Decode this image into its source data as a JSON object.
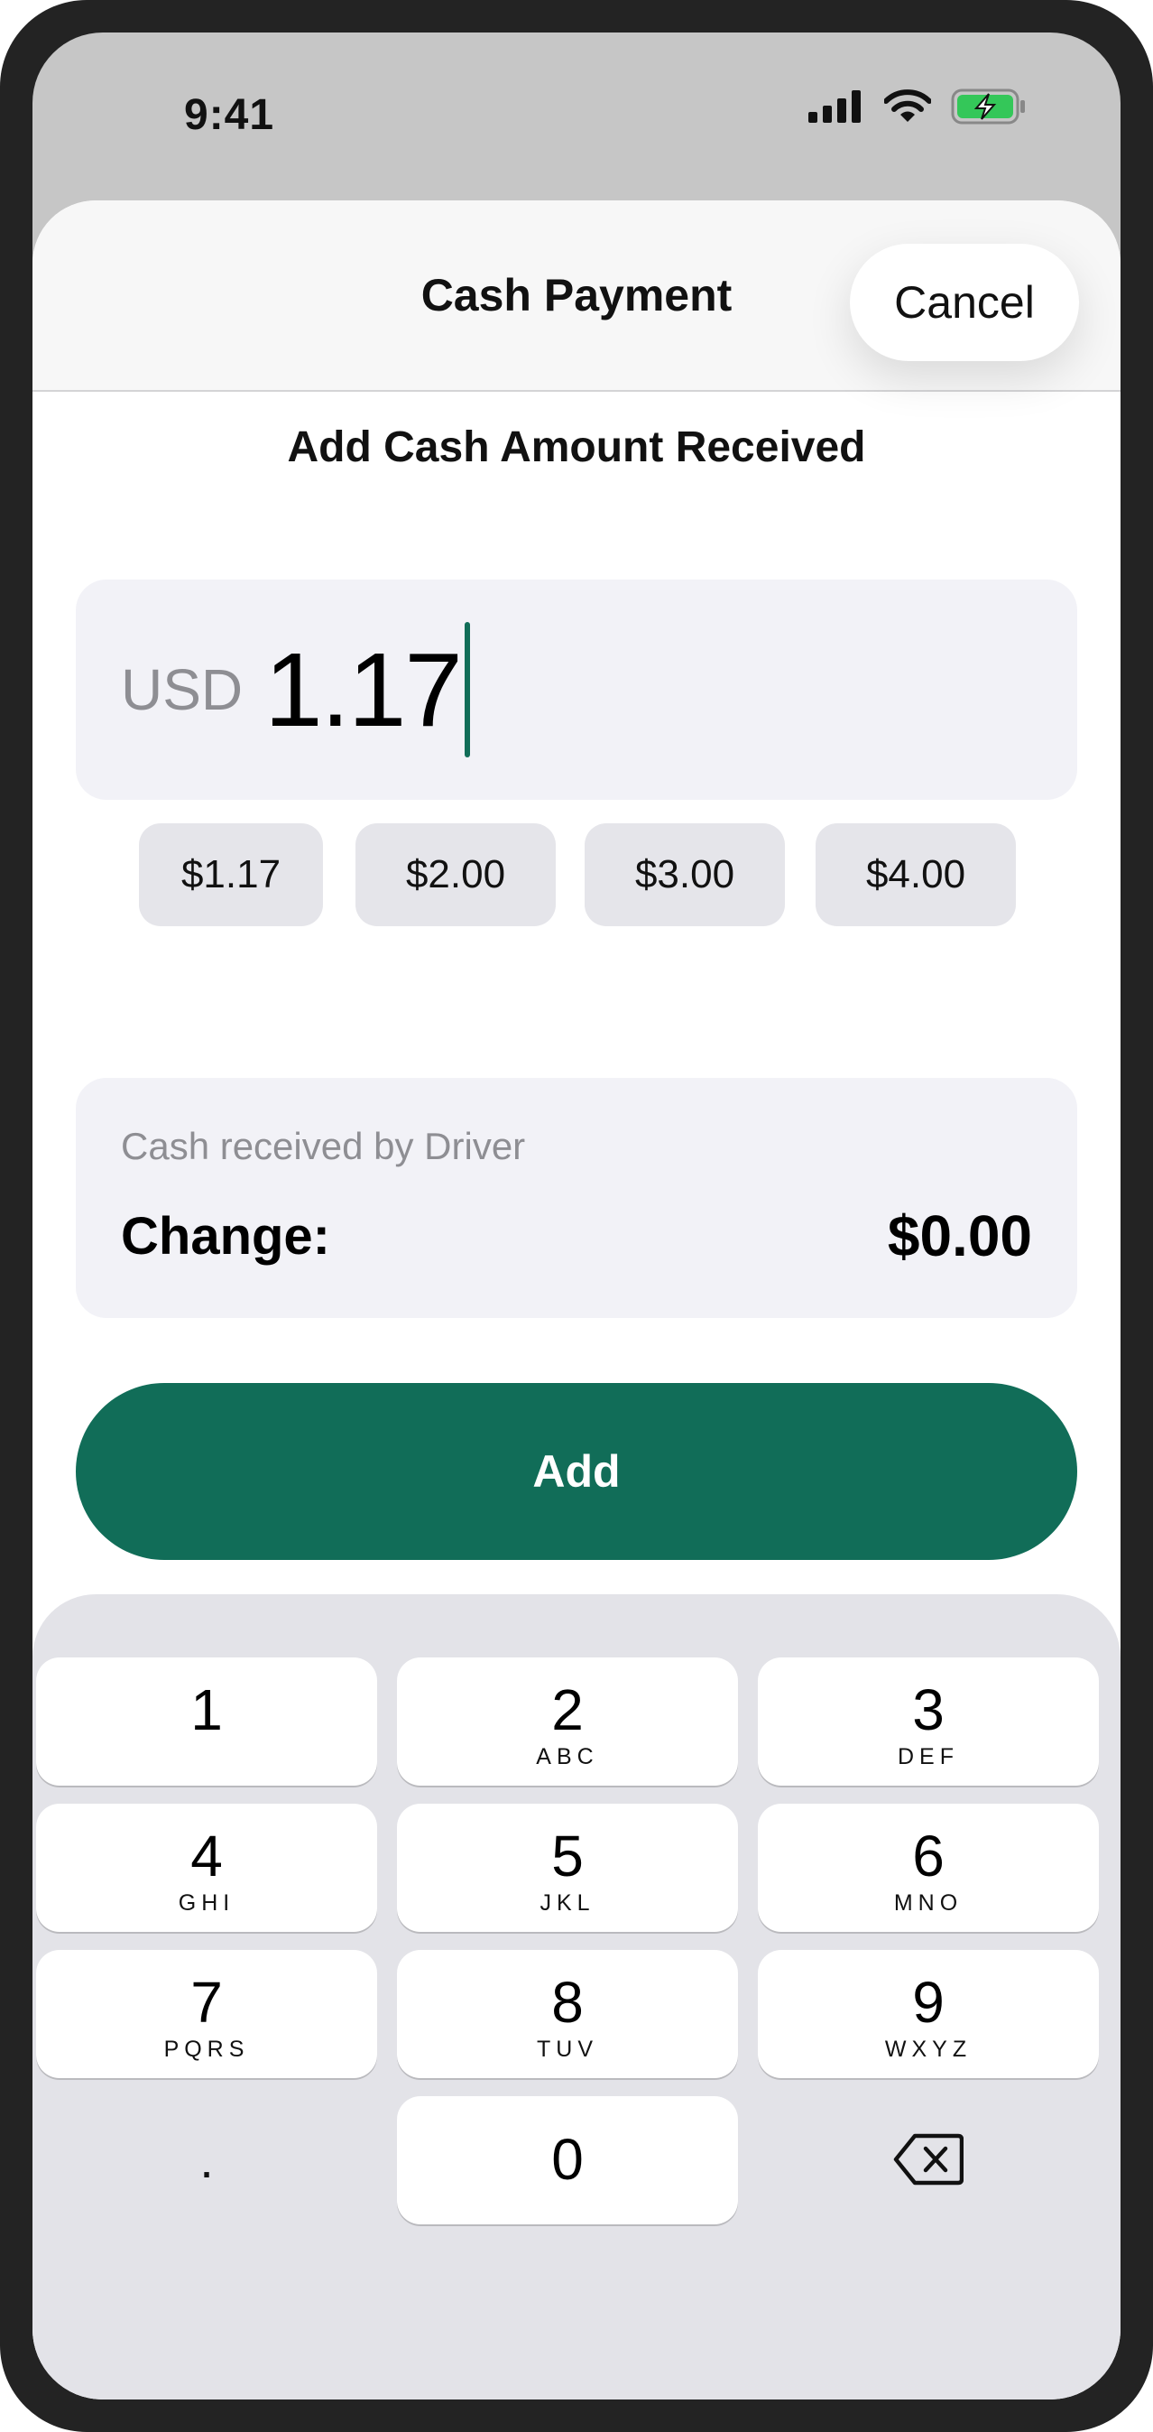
{
  "status_bar": {
    "time": "9:41"
  },
  "sheet": {
    "title": "Cash Payment",
    "cancel_label": "Cancel",
    "subtitle": "Add Cash Amount Received"
  },
  "amount_input": {
    "currency": "USD",
    "value": "1.17"
  },
  "quick_amounts": [
    "$1.17",
    "$2.00",
    "$3.00",
    "$4.00"
  ],
  "summary": {
    "caption": "Cash received by Driver",
    "change_label": "Change:",
    "change_value": "$0.00"
  },
  "add_button_label": "Add",
  "keypad": {
    "keys": [
      {
        "digit": "1",
        "letters": ""
      },
      {
        "digit": "2",
        "letters": "ABC"
      },
      {
        "digit": "3",
        "letters": "DEF"
      },
      {
        "digit": "4",
        "letters": "GHI"
      },
      {
        "digit": "5",
        "letters": "JKL"
      },
      {
        "digit": "6",
        "letters": "MNO"
      },
      {
        "digit": "7",
        "letters": "PQRS"
      },
      {
        "digit": "8",
        "letters": "TUV"
      },
      {
        "digit": "9",
        "letters": "WXYZ"
      },
      {
        "digit": "0",
        "letters": ""
      }
    ],
    "decimal": ".",
    "delete_icon": "backspace-icon"
  },
  "colors": {
    "accent": "#116d58",
    "field_background": "#f2f2f7",
    "chip_background": "#e5e5ea",
    "keypad_background": "#e3e3e8",
    "secondary_text": "#8e8e93",
    "battery_fill": "#34c759"
  }
}
